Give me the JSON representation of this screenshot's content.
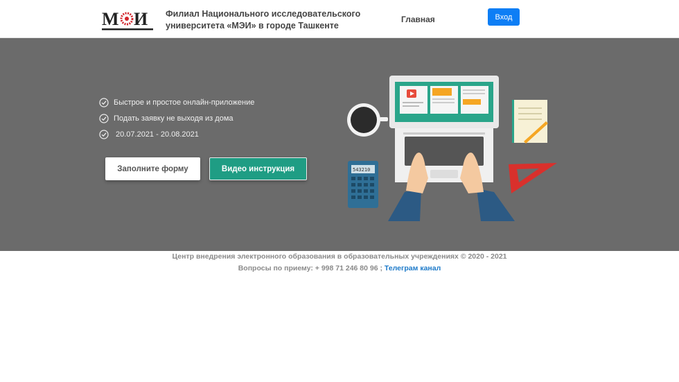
{
  "header": {
    "logo_text": "МЭИ",
    "brand_line1": "Филиал Национального исследовательского",
    "brand_line2": "университета «МЭИ» в городе Ташкенте",
    "nav_home": "Главная",
    "login_label": "Вход"
  },
  "hero": {
    "features": [
      "Быстрое и простое онлайн-приложение",
      "Подать заявку не выходя из дома",
      "20.07.2021 - 20.08.2021"
    ],
    "form_button": "Заполните форму",
    "video_button": "Видео инструкция",
    "calculator_display": "543210"
  },
  "footer": {
    "copyright": "Центр внедрения электронного образования в образовательных учреждениях © 2020 - 2021",
    "contact_prefix": "Вопросы по приему: + 998 71 246 80 96 ;",
    "telegram_link": "Телеграм канал"
  },
  "colors": {
    "hero_bg": "#6b6b6b",
    "accent_green": "#1f9d84",
    "login_blue": "#0d7ef5",
    "link_blue": "#1d7ac9"
  }
}
